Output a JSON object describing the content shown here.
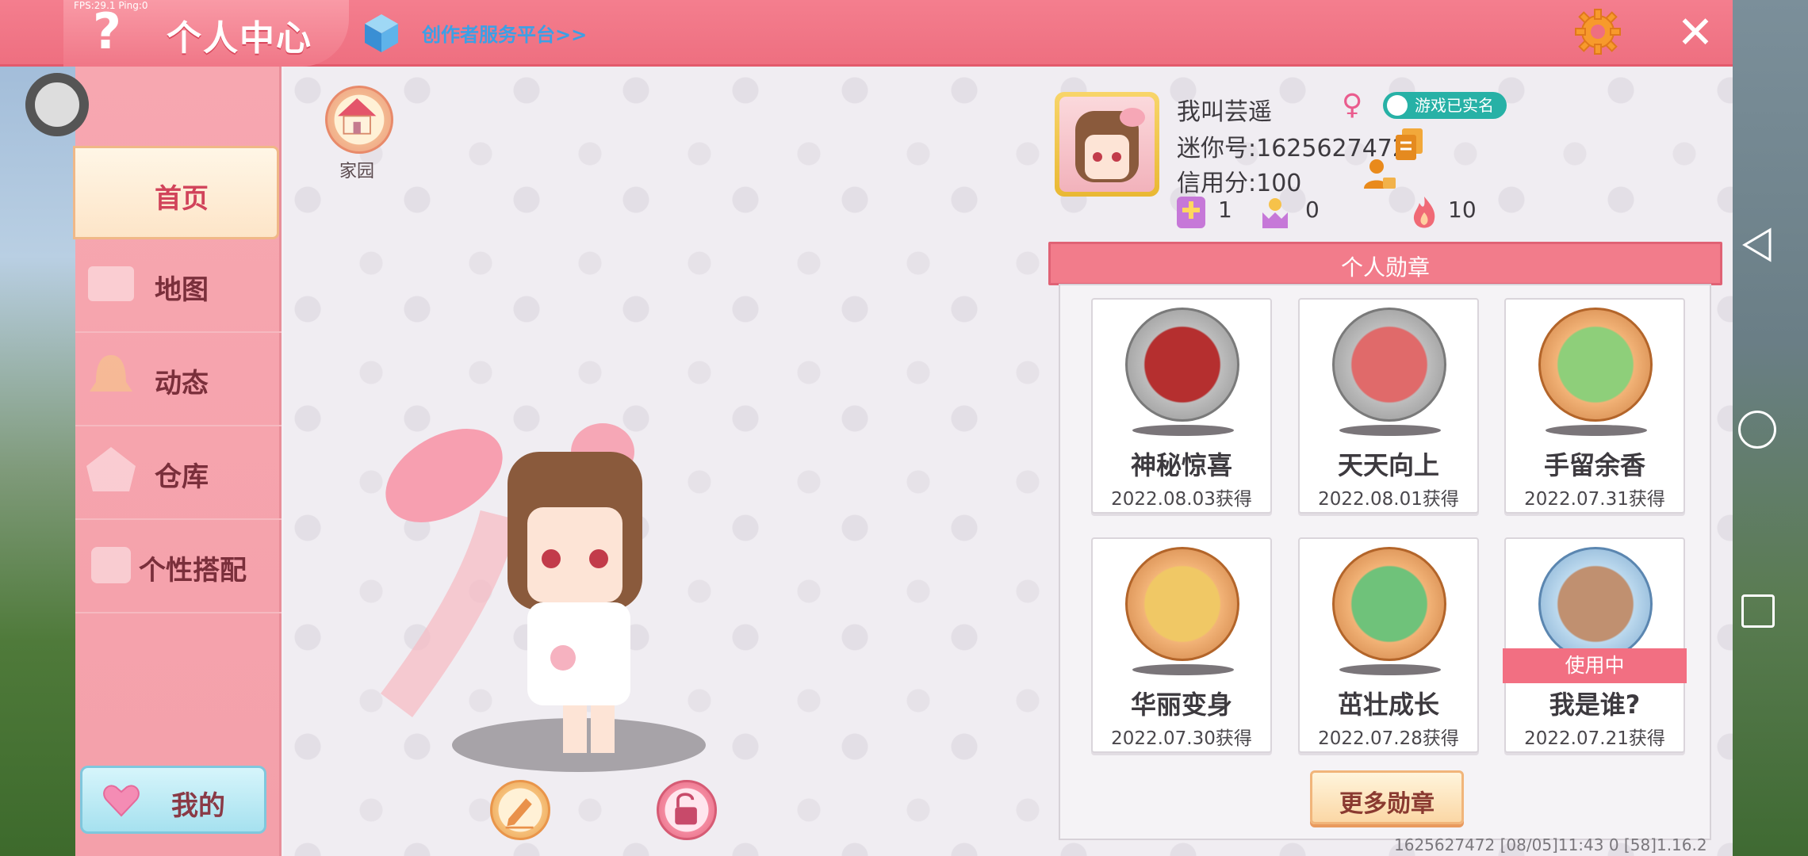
{
  "debug": {
    "fps_text": "FPS:29.1  Ping:0"
  },
  "header": {
    "help_glyph": "?",
    "title": "个人中心",
    "creator_link": "创作者服务平台>>",
    "close_glyph": "✕"
  },
  "sidebar": {
    "items": [
      {
        "label": "首页",
        "active": true
      },
      {
        "label": "地图",
        "active": false
      },
      {
        "label": "动态",
        "active": false
      },
      {
        "label": "仓库",
        "active": false
      },
      {
        "label": "个性搭配",
        "active": false
      }
    ],
    "my_button": "我的"
  },
  "home": {
    "label": "家园"
  },
  "profile": {
    "nickname": "我叫芸遥",
    "gender_glyph": "♀",
    "verified": "游戏已实名",
    "mini_id": "迷你号:1625627472",
    "credit": "信用分:100",
    "stats": [
      {
        "icon": "add-friend-icon",
        "value": "1"
      },
      {
        "icon": "fans-icon",
        "value": "0"
      },
      {
        "icon": "flame-icon",
        "value": "10"
      }
    ]
  },
  "medals": {
    "header": "个人勋章",
    "items": [
      {
        "name": "神秘惊喜",
        "date": "2022.08.03获得",
        "color": "#b52f2f"
      },
      {
        "name": "天天向上",
        "date": "2022.08.01获得",
        "color": "#e06a6a"
      },
      {
        "name": "手留余香",
        "date": "2022.07.31获得",
        "color": "#8ecf7a"
      },
      {
        "name": "华丽变身",
        "date": "2022.07.30获得",
        "color": "#f0c865"
      },
      {
        "name": "茁壮成长",
        "date": "2022.07.28获得",
        "color": "#6fc27a"
      },
      {
        "name": "我是谁?",
        "date": "2022.07.21获得",
        "color": "#c09070"
      }
    ],
    "in_use_label": "使用中",
    "more_button": "更多勋章"
  },
  "footer": {
    "info": "1625627472    [08/05]11:43 0   [58]1.16.2"
  },
  "colors": {
    "accent": "#f27c8b",
    "sidebar": "#f7a7b0",
    "teal": "#27b1a6"
  }
}
